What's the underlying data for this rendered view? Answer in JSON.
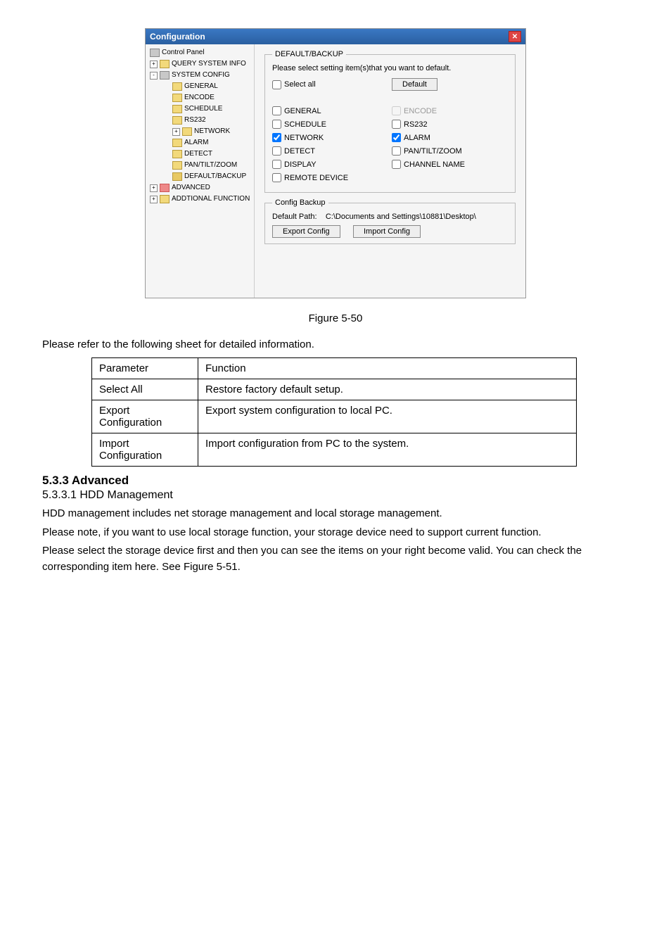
{
  "screenshot": {
    "title": "Configuration",
    "tree": {
      "root": "Control Panel",
      "query": "QUERY SYSTEM INFO",
      "sysconfig": "SYSTEM CONFIG",
      "general": "GENERAL",
      "encode": "ENCODE",
      "schedule": "SCHEDULE",
      "rs232": "RS232",
      "network": "NETWORK",
      "alarm": "ALARM",
      "detect": "DETECT",
      "ptz": "PAN/TILT/ZOOM",
      "default": "DEFAULT/BACKUP",
      "advanced": "ADVANCED",
      "addtional": "ADDTIONAL FUNCTION"
    },
    "panel": {
      "legend": "DEFAULT/BACKUP",
      "instruction": "Please select setting item(s)that you want to default.",
      "select_all": "Select all",
      "default_btn": "Default",
      "general": "GENERAL",
      "encode": "ENCODE",
      "schedule": "SCHEDULE",
      "rs232": "RS232",
      "network": "NETWORK",
      "alarm": "ALARM",
      "detect": "DETECT",
      "ptz": "PAN/TILT/ZOOM",
      "display": "DISPLAY",
      "channel": "CHANNEL NAME",
      "remote": "REMOTE DEVICE",
      "config_legend": "Config Backup",
      "path_label": "Default Path:",
      "path_value": "C:\\Documents and Settings\\10881\\Desktop\\",
      "export_btn": "Export Config",
      "import_btn": "Import Config"
    }
  },
  "figure_caption": "Figure 5-50",
  "intro_text": "Please refer to the following sheet for detailed information.",
  "table": {
    "h1": "Parameter",
    "h2": "Function",
    "r1c1": "Select All",
    "r1c2": "Restore factory default setup.",
    "r2c1a": "Export",
    "r2c1b": "Configuration",
    "r2c2": "Export system configuration to local PC.",
    "r3c1a": "Import",
    "r3c1b": "Configuration",
    "r3c2": "Import configuration from PC to the system."
  },
  "section": {
    "num_title": "5.3.3  Advanced",
    "sub_title": "5.3.3.1  HDD Management",
    "p1": "HDD management includes net storage management and local storage management.",
    "p2": "Please note, if you want to use local storage function, your storage device need to support current function.",
    "p3": "Please select the storage device first and then you can see the items on your right become valid. You can check the corresponding item here. See Figure 5-51."
  }
}
